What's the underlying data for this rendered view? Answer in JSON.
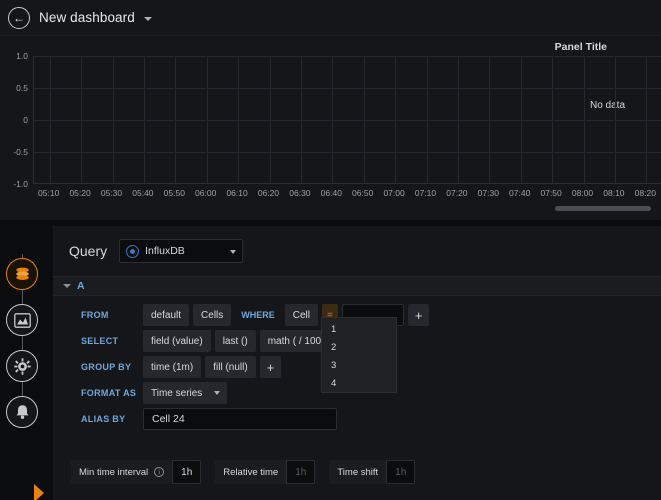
{
  "topbar": {
    "back_icon": "arrow-left-circle-icon",
    "title": "New dashboard",
    "title_caret_icon": "chevron-down-icon"
  },
  "panel": {
    "title": "Panel Title",
    "no_data_text": "No data"
  },
  "chart_data": {
    "type": "line",
    "title": "Panel Title",
    "xlabel": "",
    "ylabel": "",
    "series": [],
    "x": [
      "05:10",
      "05:20",
      "05:30",
      "05:40",
      "05:50",
      "06:00",
      "06:10",
      "06:20",
      "06:30",
      "06:40",
      "06:50",
      "07:00",
      "07:10",
      "07:20",
      "07:30",
      "07:40",
      "07:50",
      "08:00",
      "08:10",
      "08:20"
    ],
    "ytick_labels": [
      "1.0",
      "0.5",
      "0",
      "-0.5",
      "-1.0"
    ],
    "ytick_values": [
      1.0,
      0.5,
      0,
      -0.5,
      -1.0
    ],
    "ylim": [
      -1.0,
      1.0
    ],
    "grid": true,
    "legend": "none",
    "annotation": "No data"
  },
  "rail": {
    "items": [
      {
        "icon": "datasource-layers-icon",
        "active": true
      },
      {
        "icon": "visualization-graph-icon",
        "active": false
      },
      {
        "icon": "panel-settings-gear-icon",
        "active": false
      },
      {
        "icon": "alert-bell-icon",
        "active": false
      }
    ]
  },
  "query_editor": {
    "header_label": "Query",
    "datasource": {
      "icon": "influxdb-icon",
      "value": "InfluxDB",
      "caret_icon": "chevron-down-icon"
    },
    "row": {
      "collapse_icon": "chevron-down-icon",
      "name": "A"
    },
    "from": {
      "key": "FROM",
      "policy": "default",
      "measurement": "Cells",
      "where_label": "WHERE",
      "tag_key": "Cell",
      "operator": "=",
      "tag_value": "",
      "add_icon": "+"
    },
    "select": {
      "key": "SELECT",
      "parts": [
        "field (value)",
        "last ()",
        "math ( / 1000)"
      ]
    },
    "group_by": {
      "key": "GROUP BY",
      "parts": [
        "time (1m)",
        "fill (null)"
      ],
      "add_icon": "+"
    },
    "format_as": {
      "key": "FORMAT AS",
      "value": "Time series",
      "caret_icon": "chevron-down-icon"
    },
    "alias_by": {
      "key": "ALIAS BY",
      "value": "Cell 24"
    },
    "typeahead_options": [
      "1",
      "2",
      "3",
      "4"
    ]
  },
  "options": {
    "min_time_interval": {
      "label": "Min time interval",
      "info_icon": "info-icon",
      "value": "1h"
    },
    "relative_time": {
      "label": "Relative time",
      "placeholder": "1h"
    },
    "time_shift": {
      "label": "Time shift",
      "placeholder": "1h"
    }
  },
  "colors": {
    "accent_blue": "#6fa8dc",
    "accent_orange": "#e8820c",
    "panel_bg": "#141619",
    "app_bg": "#0b0c0e"
  }
}
